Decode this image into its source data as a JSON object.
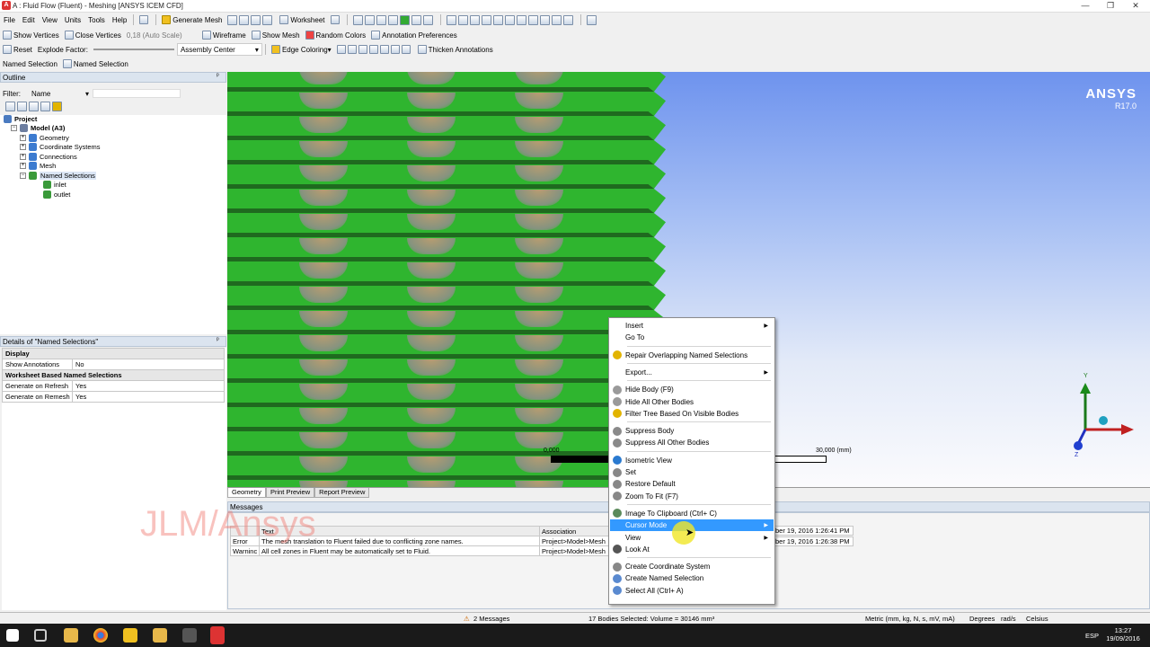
{
  "window": {
    "title": "A : Fluid Flow (Fluent) - Meshing [ANSYS ICEM CFD]",
    "min": "—",
    "max": "❐",
    "close": "✕"
  },
  "menu": [
    "File",
    "Edit",
    "View",
    "Units",
    "Tools",
    "Help"
  ],
  "toolbar1": {
    "generate_mesh": "Generate Mesh",
    "worksheet": "Worksheet"
  },
  "toolbar2": {
    "show_vertices": "Show Vertices",
    "close_vertices": "Close Vertices",
    "scale": "0,18 (Auto Scale)",
    "wireframe": "Wireframe",
    "show_mesh": "Show Mesh",
    "random_colors": "Random Colors",
    "annotation_prefs": "Annotation Preferences"
  },
  "toolbar3": {
    "reset": "Reset",
    "explode_factor": "Explode Factor:",
    "assembly_center": "Assembly Center",
    "edge_coloring": "Edge Coloring",
    "thicken": "Thicken Annotations"
  },
  "toolbar4": {
    "named_selection": "Named Selection",
    "named_selection2": "Named Selection"
  },
  "outline": {
    "title": "Outline",
    "pin": "ᵖ",
    "filter_label": "Filter:",
    "filter_value": "Name",
    "tree": [
      {
        "label": "Project",
        "bold": true
      },
      {
        "label": "Model (A3)",
        "bold": true
      },
      {
        "label": "Geometry"
      },
      {
        "label": "Coordinate Systems"
      },
      {
        "label": "Connections"
      },
      {
        "label": "Mesh"
      },
      {
        "label": "Named Selections"
      },
      {
        "label": "inlet"
      },
      {
        "label": "outlet"
      }
    ]
  },
  "details": {
    "title": "Details of \"Named Selections\"",
    "rows": [
      {
        "k": "Display",
        "v": "",
        "group": true
      },
      {
        "k": "Show Annotations",
        "v": "No"
      },
      {
        "k": "Worksheet Based Named Selections",
        "v": "",
        "group": true
      },
      {
        "k": "Generate on Refresh",
        "v": "Yes"
      },
      {
        "k": "Generate on Remesh",
        "v": "Yes"
      }
    ]
  },
  "viewport": {
    "brand": "ANSYS",
    "version": "R17.0",
    "scale_start": "0,000",
    "scale_end": "30,000 (mm)",
    "axis_y": "Y",
    "axis_z": "Z"
  },
  "view_tabs": [
    "Geometry",
    "Print Preview",
    "Report Preview"
  ],
  "messages": {
    "title": "Messages",
    "watermark": "JLM/Ansys",
    "headers": [
      "",
      "Text",
      "Association"
    ],
    "rows": [
      {
        "type": "Error",
        "text": "The mesh translation to Fluent failed due to conflicting zone names.",
        "assoc": "Project>Model>Mesh",
        "time": "ber 19, 2016 1:26:41 PM"
      },
      {
        "type": "Warninc",
        "text": "All cell zones in Fluent may be automatically set to Fluid.",
        "assoc": "Project>Model>Mesh",
        "time": "ber 19, 2016 1:26:38 PM"
      }
    ]
  },
  "context_menu": [
    {
      "label": "Insert",
      "sub": true
    },
    {
      "label": "Go To"
    },
    {
      "sep": true
    },
    {
      "label": "Repair Overlapping Named Selections",
      "icon": "#e2b400"
    },
    {
      "sep": true
    },
    {
      "label": "Export...",
      "sub": true
    },
    {
      "sep": true
    },
    {
      "label": "Hide Body (F9)",
      "icon": "#9a9a9a"
    },
    {
      "label": "Hide All Other Bodies",
      "icon": "#9a9a9a"
    },
    {
      "label": "Filter Tree Based On Visible Bodies",
      "icon": "#e2b400"
    },
    {
      "sep": true
    },
    {
      "label": "Suppress Body",
      "icon": "#8a8a8a"
    },
    {
      "label": "Suppress All Other Bodies",
      "icon": "#8a8a8a"
    },
    {
      "sep": true
    },
    {
      "label": "Isometric View",
      "icon": "#2a7ad0"
    },
    {
      "label": "Set",
      "icon": "#888"
    },
    {
      "label": "Restore Default",
      "icon": "#888"
    },
    {
      "label": "Zoom To Fit (F7)",
      "icon": "#888"
    },
    {
      "sep": true
    },
    {
      "label": "Image To Clipboard (Ctrl+ C)",
      "icon": "#5a8a5a"
    },
    {
      "label": "Cursor Mode",
      "sub": true,
      "highlight": true
    },
    {
      "label": "View",
      "sub": true
    },
    {
      "label": "Look At",
      "icon": "#555"
    },
    {
      "sep": true
    },
    {
      "label": "Create Coordinate System",
      "icon": "#888"
    },
    {
      "label": "Create Named Selection",
      "icon": "#5a8ad0"
    },
    {
      "label": "Select All (Ctrl+ A)",
      "icon": "#5a8ad0"
    }
  ],
  "status": {
    "messages": "2 Messages",
    "selection": "17 Bodies Selected: Volume = 30146 mm³",
    "units": "Metric (mm, kg, N, s, mV, mA)",
    "degrees": "Degrees",
    "rads": "rad/s",
    "celsius": "Celsius"
  },
  "taskbar": {
    "lang": "ESP",
    "time": "13:27",
    "date": "19/09/2016"
  }
}
